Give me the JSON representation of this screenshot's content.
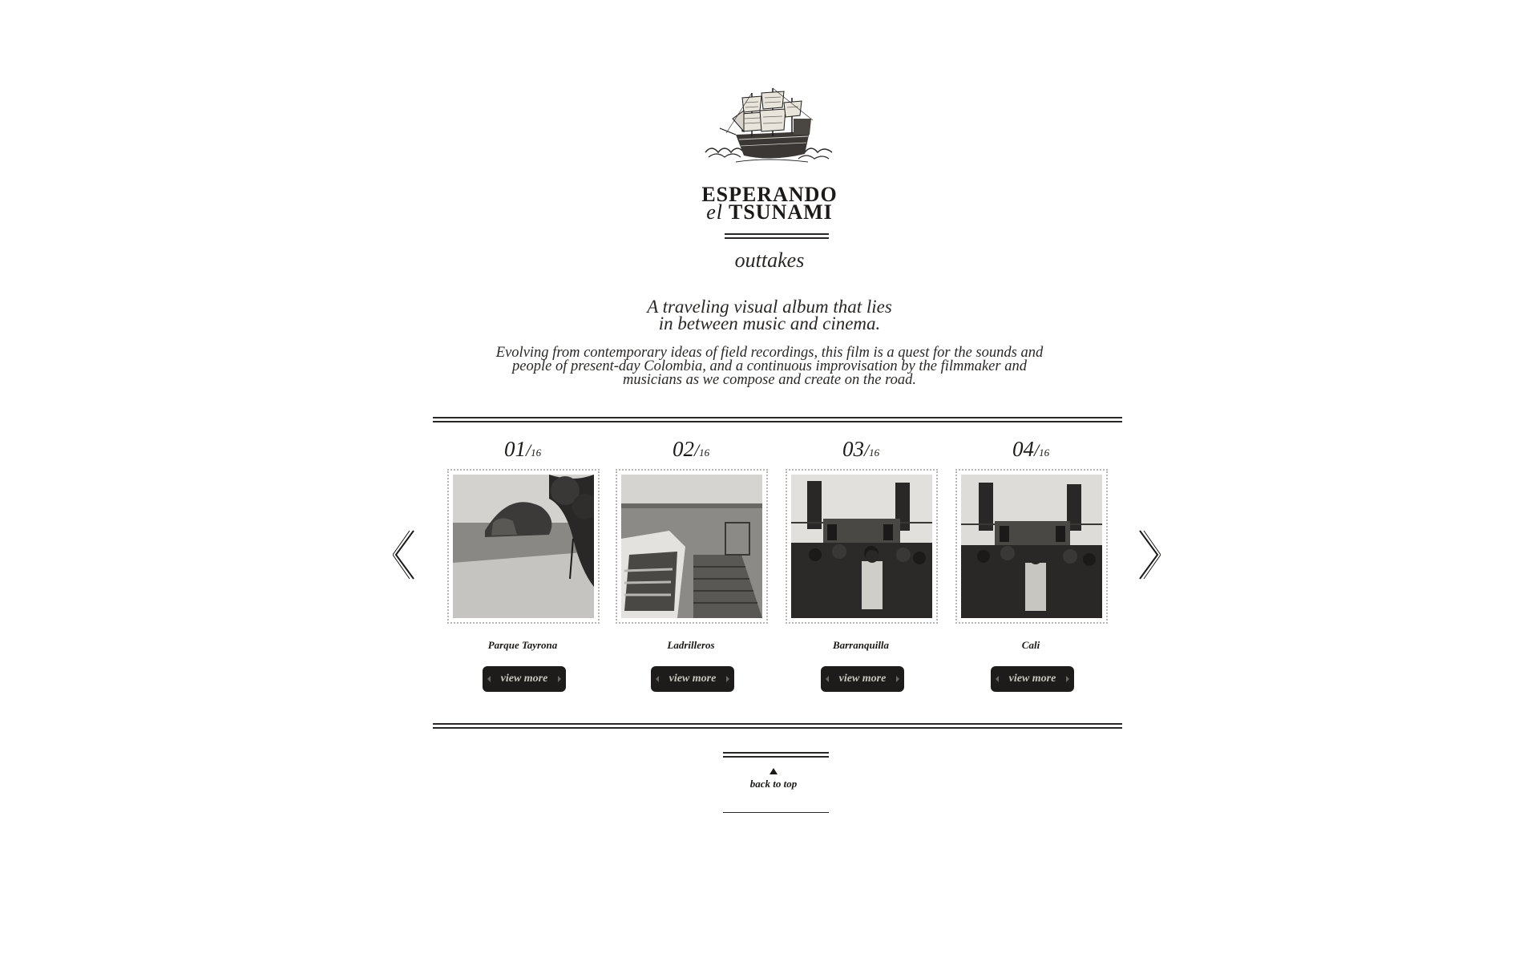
{
  "header": {
    "title_line1": "ESPERANDO",
    "title_line2_italic": "el",
    "title_line2": "TSUNAMI",
    "subtitle": "outtakes",
    "logo_icon": "ship-icon"
  },
  "intro": {
    "tagline_line1": "A traveling visual album that lies",
    "tagline_line2": "in between music and cinema.",
    "description_line1": "Evolving from contemporary ideas of field recordings, this film is a quest for the sounds and",
    "description_line2": "people of present-day Colombia, and a continuous improvisation by the filmmaker and",
    "description_line3": "musicians as we compose and create on the road."
  },
  "gallery": {
    "prev_icon": "chevron-left-icon",
    "next_icon": "chevron-right-icon",
    "items": [
      {
        "number": "01",
        "slash": "/",
        "total": "16",
        "place": "Parque Tayrona",
        "button": "view more",
        "photo": "beach-photo"
      },
      {
        "number": "02",
        "slash": "/",
        "total": "16",
        "place": "Ladrilleros",
        "button": "view more",
        "photo": "boat-dock-photo"
      },
      {
        "number": "03",
        "slash": "/",
        "total": "16",
        "place": "Barranquilla",
        "button": "view more",
        "photo": "concert-crowd-photo"
      },
      {
        "number": "04",
        "slash": "/",
        "total": "16",
        "place": "Cali",
        "button": "view more",
        "photo": "concert-crowd-photo"
      }
    ]
  },
  "footer": {
    "back_to_top": "back to top",
    "back_icon": "triangle-up-icon"
  },
  "colors": {
    "ink": "#1c1a18",
    "button_bg": "#1e1c1a",
    "button_text": "#c9c6c0",
    "frame_border": "#b8b6b2",
    "background": "#ffffff"
  }
}
